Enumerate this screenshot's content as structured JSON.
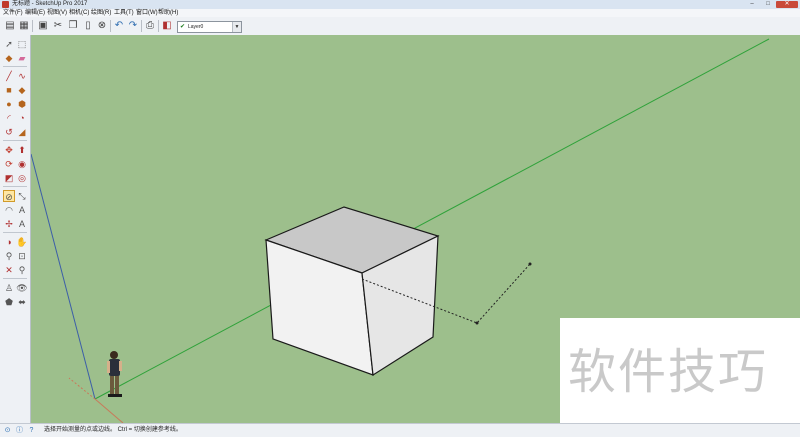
{
  "window": {
    "title": "无标题 - SketchUp Pro 2017",
    "minimize": "–",
    "maximize": "□",
    "close": "✕"
  },
  "menu": [
    "文件(F)",
    "编辑(E)",
    "视图(V)",
    "相机(C)",
    "绘图(R)",
    "工具(T)",
    "窗口(W)",
    "帮助(H)"
  ],
  "toolbar": {
    "layer": {
      "check": "✔",
      "name": "Layer0",
      "arrow": "▼"
    }
  },
  "icons": {
    "toolbar": [
      "new-file-icon",
      "open-file-icon",
      "save-icon",
      "cut-icon",
      "copy-icon",
      "paste-icon",
      "erase-icon",
      "undo-icon",
      "redo-icon",
      "print-icon",
      "model-info-icon"
    ],
    "palette": [
      "select-icon",
      "make-component-icon",
      "paint-bucket-icon",
      "eraser-icon",
      "line-icon",
      "freehand-icon",
      "rectangle-icon",
      "rotated-rectangle-icon",
      "circle-icon",
      "polygon-icon",
      "arc-icon",
      "pie-icon",
      "move-icon",
      "push-pull-icon",
      "rotate-icon",
      "follow-me-icon",
      "scale-icon",
      "offset-icon",
      "tape-measure-icon",
      "dimension-icon",
      "protractor-icon",
      "text-icon",
      "axes-icon",
      "3d-text-icon",
      "orbit-icon",
      "pan-icon",
      "zoom-icon",
      "zoom-window-icon",
      "zoom-extents-icon",
      "previous-view-icon",
      "position-camera-icon",
      "look-around-icon",
      "walk-icon",
      "section-plane-icon"
    ],
    "status": [
      "geo-location-icon",
      "credits-icon",
      "help-icon"
    ]
  },
  "status": {
    "text": "选择开始测量的点或边线。 Ctrl = 切换创建参考线。"
  },
  "watermark": {
    "text": "软件技巧"
  },
  "colors": {
    "viewport_bg": "#9dbf8c",
    "green_axis": "#2fa23a",
    "blue_axis": "#3c5ea8",
    "red_axis": "#c9795a",
    "cube_top": "#c8c8c8",
    "cube_front": "#f2f2f2",
    "cube_side": "#e6e6e6"
  }
}
